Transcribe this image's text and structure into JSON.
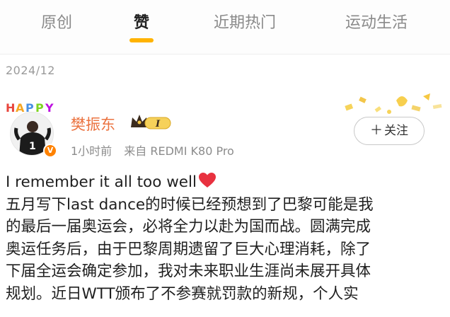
{
  "tabs": [
    {
      "label": "原创",
      "active": false
    },
    {
      "label": "赞",
      "active": true
    },
    {
      "label": "近期热门",
      "active": false
    },
    {
      "label": "运动生活",
      "active": false
    }
  ],
  "accent_color": "#ffb300",
  "date": "2024/12",
  "post": {
    "avatar_banner": "HAPPY",
    "avatar_jersey_number": "1",
    "verified_badge": "V",
    "username": "樊振东",
    "username_color": "#eb7340",
    "level_badge": "I",
    "time": "1小时前",
    "source": "来自 REDMI K80 Pro",
    "follow_label": "关注",
    "follow_icon": "plus-icon",
    "content_lines": [
      "I remember it all too well",
      "五月写下last dance的时候已经预想到了巴黎可能是我",
      "的最后一届奥运会，必将全力以赴为国而战。圆满完成",
      "奥运任务后，由于巴黎周期遗留了巨大心理消耗，除了",
      "下届全运会确定参加，我对未来职业生涯尚未展开具体",
      "规划。近日WTT颁布了不参赛就罚款的新规，个人实"
    ],
    "heart_icon": "red-heart-icon"
  }
}
